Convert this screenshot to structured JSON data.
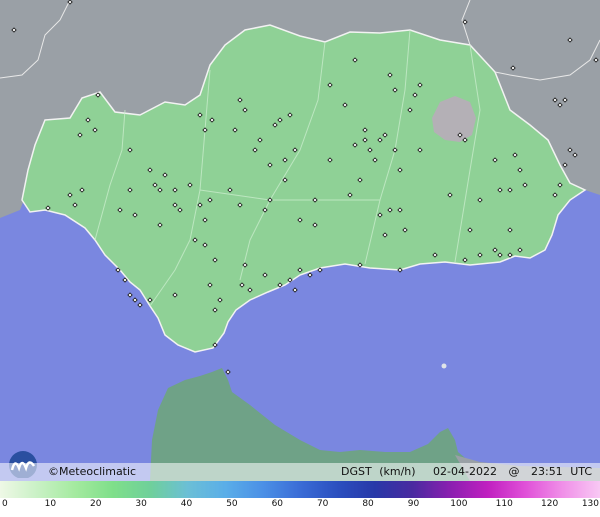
{
  "brand": {
    "copyright_symbol": "©",
    "name": "Meteoclimatic"
  },
  "info": {
    "variable": "DGST",
    "unit": "(km/h)",
    "date": "02-04-2022",
    "at": "@",
    "time": "23:51",
    "tz": "UTC"
  },
  "scale": {
    "ticks": [
      "0",
      "10",
      "20",
      "30",
      "40",
      "50",
      "60",
      "70",
      "80",
      "90",
      "100",
      "110",
      "120",
      "130"
    ],
    "colors": [
      "#eef8e6",
      "#c9f1c5",
      "#a4ea9f",
      "#7fdf8a",
      "#6fd09a",
      "#6bbfd6",
      "#5aaee8",
      "#4b90e6",
      "#3a6cd6",
      "#2b4fbf",
      "#2838a8",
      "#4a2aa0",
      "#8a1fb0",
      "#c020c0",
      "#e050d8",
      "#f090e8",
      "#f8c8f4"
    ]
  },
  "map": {
    "colors": {
      "sea": "#7a87e0",
      "land_outside": "#9aa0a6",
      "region": "#8fd196",
      "region_border": "#f2f2f2",
      "north_africa": "#6fa287",
      "snow_patch": "#b4b0b6"
    },
    "stations_icon": "station-marker-icon"
  }
}
